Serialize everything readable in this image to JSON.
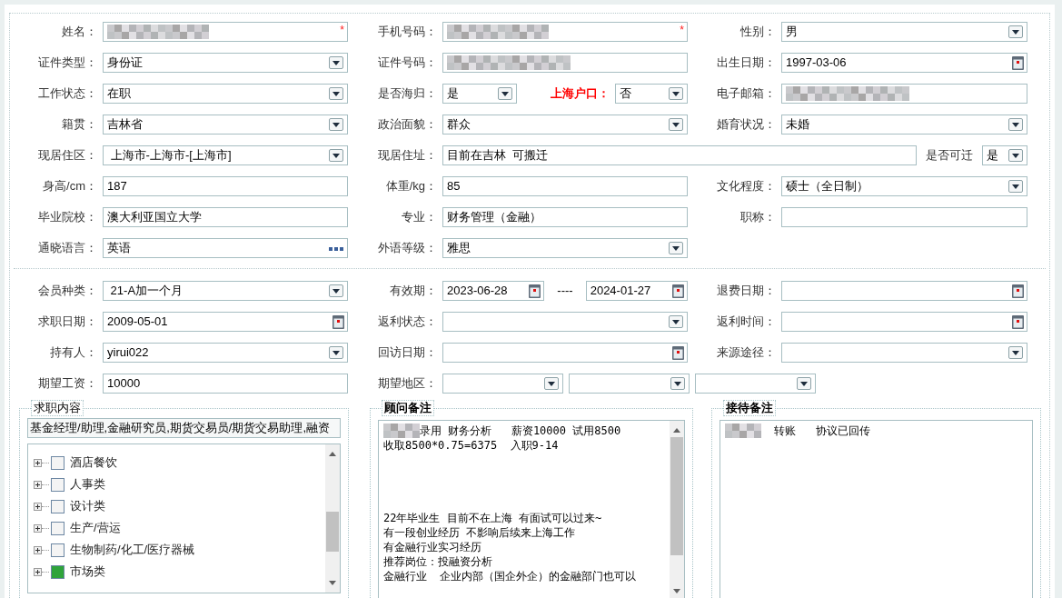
{
  "profile_rows": [
    [
      {
        "label": "姓名：",
        "fields": [
          {
            "kind": "masked",
            "required_mark": "*"
          }
        ]
      },
      {
        "label": "手机号码：",
        "fields": [
          {
            "kind": "masked",
            "required_mark": "*"
          }
        ]
      },
      {
        "label": "性别：",
        "fields": [
          {
            "kind": "select",
            "value": "男"
          }
        ]
      }
    ],
    [
      {
        "label": "证件类型：",
        "fields": [
          {
            "kind": "select",
            "value": "身份证"
          }
        ]
      },
      {
        "label": "证件号码：",
        "fields": [
          {
            "kind": "masked"
          }
        ]
      },
      {
        "label": "出生日期：",
        "fields": [
          {
            "kind": "date",
            "value": "1997-03-06"
          }
        ]
      }
    ],
    [
      {
        "label": "工作状态：",
        "fields": [
          {
            "kind": "select",
            "value": "在职"
          }
        ]
      },
      {
        "label": "是否海归：",
        "fields": [
          {
            "kind": "select",
            "value": "是"
          },
          {
            "kind": "select",
            "value": "否",
            "label": "上海户口：",
            "color": "#ff0000"
          }
        ]
      },
      {
        "label": "电子邮箱：",
        "fields": [
          {
            "kind": "masked"
          }
        ]
      }
    ],
    [
      {
        "label": "籍贯：",
        "fields": [
          {
            "kind": "select",
            "value": "吉林省"
          }
        ]
      },
      {
        "label": "政治面貌：",
        "fields": [
          {
            "kind": "select",
            "value": "群众"
          }
        ]
      },
      {
        "label": "婚育状况：",
        "fields": [
          {
            "kind": "select",
            "value": "未婚"
          }
        ]
      }
    ],
    [
      {
        "label": "现居住区：",
        "fields": [
          {
            "kind": "select",
            "value": " 上海市-上海市-[上海市]"
          }
        ]
      },
      {
        "label": "现居住址：",
        "wide": true,
        "fields": [
          {
            "kind": "text",
            "value": "目前在吉林  可搬迁"
          },
          {
            "kind": "select",
            "value": "是",
            "label": "是否可迁"
          }
        ]
      }
    ],
    [
      {
        "label": "身高/cm：",
        "fields": [
          {
            "kind": "text",
            "value": "187"
          }
        ]
      },
      {
        "label": "体重/kg：",
        "fields": [
          {
            "kind": "text",
            "value": "85"
          }
        ]
      },
      {
        "label": "文化程度：",
        "fields": [
          {
            "kind": "select",
            "value": "硕士（全日制）"
          }
        ]
      }
    ],
    [
      {
        "label": "毕业院校：",
        "fields": [
          {
            "kind": "text",
            "value": "澳大利亚国立大学"
          }
        ]
      },
      {
        "label": "专业：",
        "fields": [
          {
            "kind": "text",
            "value": "财务管理（金融）"
          }
        ]
      },
      {
        "label": "职称：",
        "fields": [
          {
            "kind": "text"
          }
        ]
      }
    ],
    [
      {
        "label": "通晓语言：",
        "fields": [
          {
            "kind": "lookup",
            "value": "英语"
          }
        ]
      },
      {
        "label": "外语等级：",
        "fields": [
          {
            "kind": "select",
            "value": "雅思"
          }
        ]
      }
    ]
  ],
  "membership_rows": [
    [
      {
        "label": "会员种类：",
        "fields": [
          {
            "kind": "select",
            "value": " 21-A加一个月"
          }
        ]
      },
      {
        "label": "有效期：",
        "fields": [
          {
            "kind": "date",
            "value": "2023-06-28"
          },
          {
            "kind": "separator",
            "value": "----"
          },
          {
            "kind": "date",
            "value": "2024-01-27"
          }
        ]
      },
      {
        "label": "退费日期：",
        "fields": [
          {
            "kind": "date"
          }
        ]
      }
    ],
    [
      {
        "label": "求职日期：",
        "fields": [
          {
            "kind": "date",
            "value": "2009-05-01"
          }
        ]
      },
      {
        "label": "返利状态：",
        "fields": [
          {
            "kind": "select"
          }
        ]
      },
      {
        "label": "返利时间：",
        "fields": [
          {
            "kind": "date"
          }
        ]
      }
    ],
    [
      {
        "label": "持有人：",
        "fields": [
          {
            "kind": "select",
            "value": "yirui022"
          }
        ]
      },
      {
        "label": "回访日期：",
        "fields": [
          {
            "kind": "date"
          }
        ]
      },
      {
        "label": "来源途径：",
        "fields": [
          {
            "kind": "select"
          }
        ]
      }
    ],
    [
      {
        "label": "期望工资：",
        "fields": [
          {
            "kind": "text",
            "value": "10000"
          }
        ]
      },
      {
        "label": "期望地区：",
        "wide": true,
        "fields": [
          {
            "kind": "select"
          },
          {
            "kind": "select"
          },
          {
            "kind": "select"
          }
        ]
      }
    ]
  ],
  "job_content": {
    "legend": "求职内容",
    "summary": "基金经理/助理,金融研究员,期货交易员/期货交易助理,融资",
    "tree": [
      {
        "label": "酒店餐饮",
        "expanded": false,
        "checked": false
      },
      {
        "label": "人事类",
        "expanded": false,
        "checked": false
      },
      {
        "label": "设计类",
        "expanded": false,
        "checked": false
      },
      {
        "label": "生产/营运",
        "expanded": false,
        "checked": false
      },
      {
        "label": "生物制药/化工/医疗器械",
        "expanded": false,
        "checked": false
      },
      {
        "label": "市场类",
        "expanded": false,
        "checked": true
      }
    ]
  },
  "advisor_notes": {
    "legend": "顾问备注",
    "paragraphs": [
      {
        "lines": [
          {
            "masked": true,
            "text": "录用 财务分析   薪资10000 试用8500"
          },
          {
            "masked": false,
            "text": "收取8500*0.75=6375  入职9-14"
          }
        ]
      },
      {
        "lines": [
          {
            "masked": false,
            "text": "22年毕业生 目前不在上海 有面试可以过来~"
          },
          {
            "masked": false,
            "text": "有一段创业经历 不影响后续来上海工作"
          },
          {
            "masked": false,
            "text": "有金融行业实习经历"
          },
          {
            "masked": false,
            "text": "推荐岗位：投融资分析"
          },
          {
            "masked": false,
            "text": "金融行业  企业内部（国企外企）的金融部门也可以"
          }
        ]
      }
    ]
  },
  "reception_notes": {
    "legend": "接待备注",
    "paragraphs": [
      {
        "lines": [
          {
            "masked": true,
            "text": "  转账   协议已回传"
          }
        ]
      }
    ]
  }
}
